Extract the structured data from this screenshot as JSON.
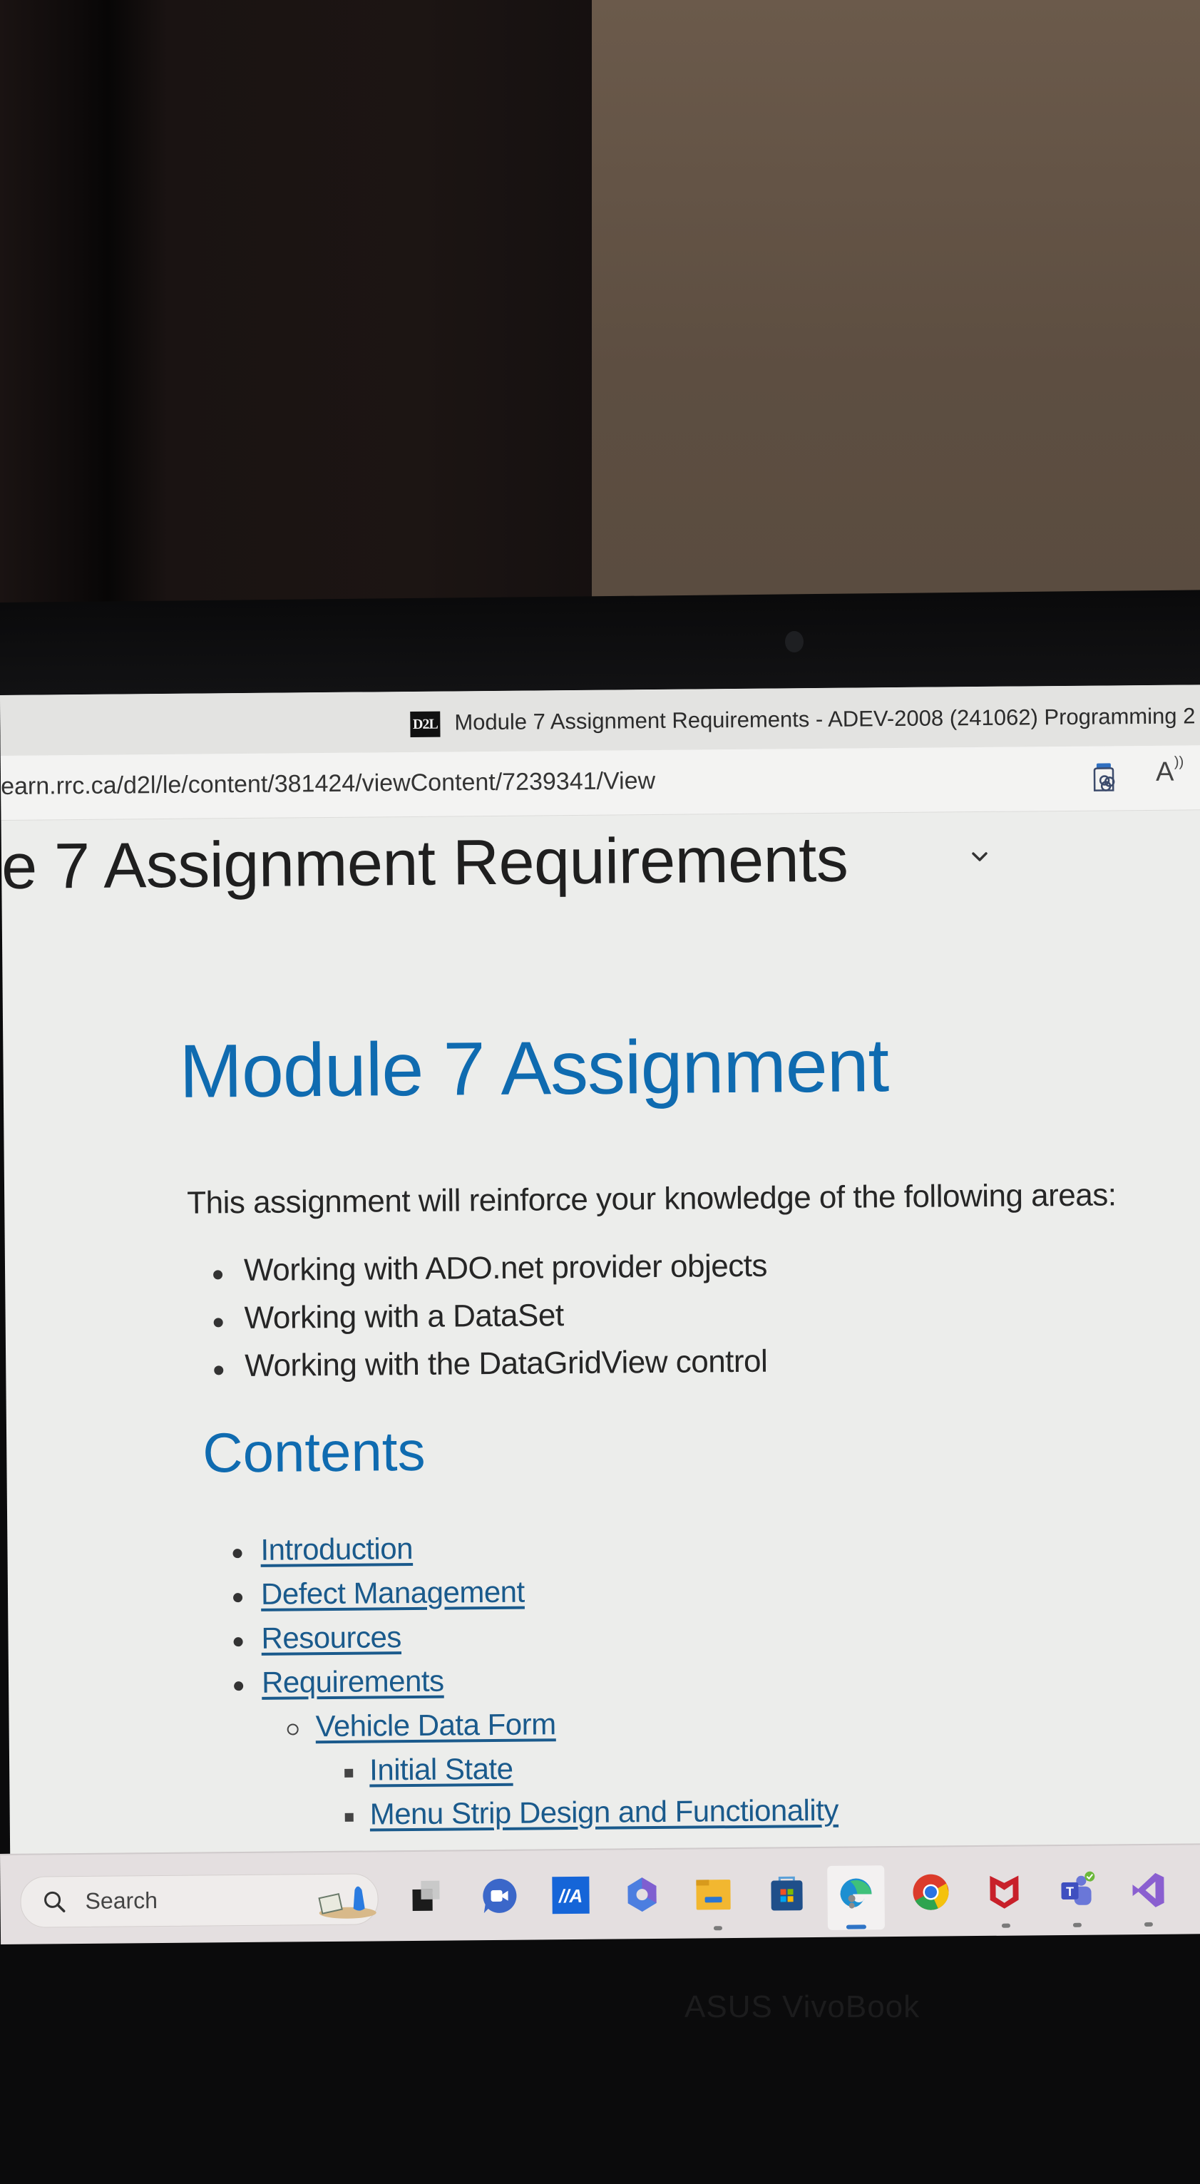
{
  "browser": {
    "tab_title": "Module 7 Assignment Requirements - ADEV-2008 (241062) Programming 2",
    "favicon_text": "D2L",
    "url": "earn.rrc.ca/d2l/le/content/381424/viewContent/7239341/View",
    "toolbar_icons": [
      "extension-icon",
      "read-aloud-icon"
    ]
  },
  "page": {
    "header_title": "e 7 Assignment Requirements",
    "heading": "Module 7 Assignment",
    "intro": "This assignment will reinforce your knowledge of the following areas:",
    "areas": [
      "Working with ADO.net provider objects",
      "Working with a DataSet",
      "Working with the DataGridView control"
    ],
    "contents_heading": "Contents",
    "contents": [
      {
        "label": "Introduction",
        "level": 1
      },
      {
        "label": "Defect Management",
        "level": 1
      },
      {
        "label": "Resources",
        "level": 1
      },
      {
        "label": "Requirements",
        "level": 1
      },
      {
        "label": "Vehicle Data Form",
        "level": 2
      },
      {
        "label": "Initial State",
        "level": 3
      },
      {
        "label": "Menu Strip Design and Functionality",
        "level": 3
      }
    ],
    "link_color": "#1a5a8c",
    "heading_color": "#0f6bb0"
  },
  "taskbar": {
    "search_label": "Search",
    "apps": [
      {
        "name": "task-view"
      },
      {
        "name": "meet-now"
      },
      {
        "name": "ma-app"
      },
      {
        "name": "microsoft-365-copilot"
      },
      {
        "name": "file-explorer"
      },
      {
        "name": "microsoft-store"
      },
      {
        "name": "microsoft-edge",
        "active": true
      },
      {
        "name": "google-chrome"
      },
      {
        "name": "mcafee"
      },
      {
        "name": "microsoft-teams"
      },
      {
        "name": "visual-studio"
      }
    ]
  },
  "device": {
    "brand": "ASUS VivoBook"
  }
}
